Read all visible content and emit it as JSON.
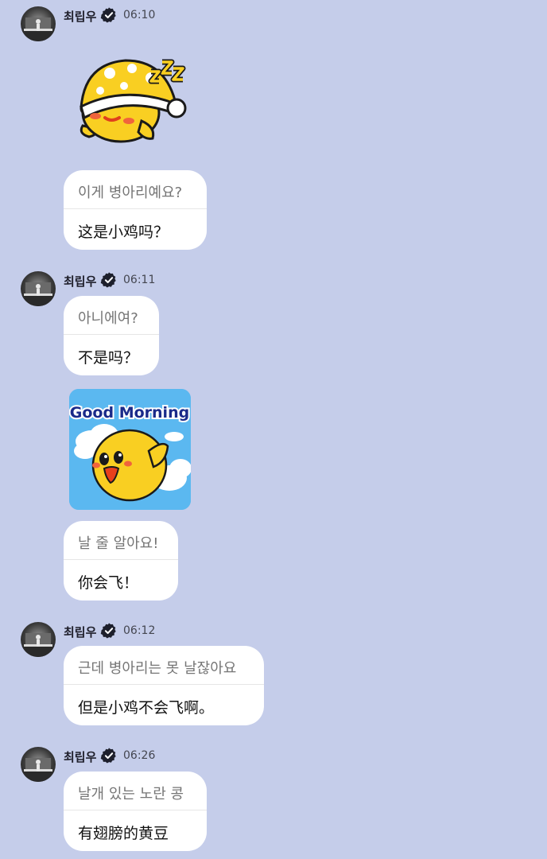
{
  "posts": [
    {
      "sender": "최립우",
      "time": "06:10"
    },
    {
      "sender": "최립우",
      "time": "06:11"
    },
    {
      "sender": "최립우",
      "time": "06:12"
    },
    {
      "sender": "최립우",
      "time": "06:26"
    }
  ],
  "messages": [
    {
      "original": "이게 병아리예요?",
      "translation": "这是小鸡吗？"
    },
    {
      "original": "아니에여?",
      "translation": "不是吗？"
    },
    {
      "original": "날 줄 알아요!",
      "translation": "你会飞！"
    },
    {
      "original": "근데 병아리는 못 날잖아요",
      "translation": "但是小鸡不会飞啊。"
    },
    {
      "original": "날개 있는 노란 콩",
      "translation": "有翅膀的黄豆"
    }
  ],
  "stickers": {
    "good_morning_text": "Good Morning"
  },
  "colors": {
    "background": "#c5cdea",
    "bubble": "#ffffff",
    "chick_yellow": "#f9cf22",
    "sky_blue": "#5bb8f0"
  }
}
